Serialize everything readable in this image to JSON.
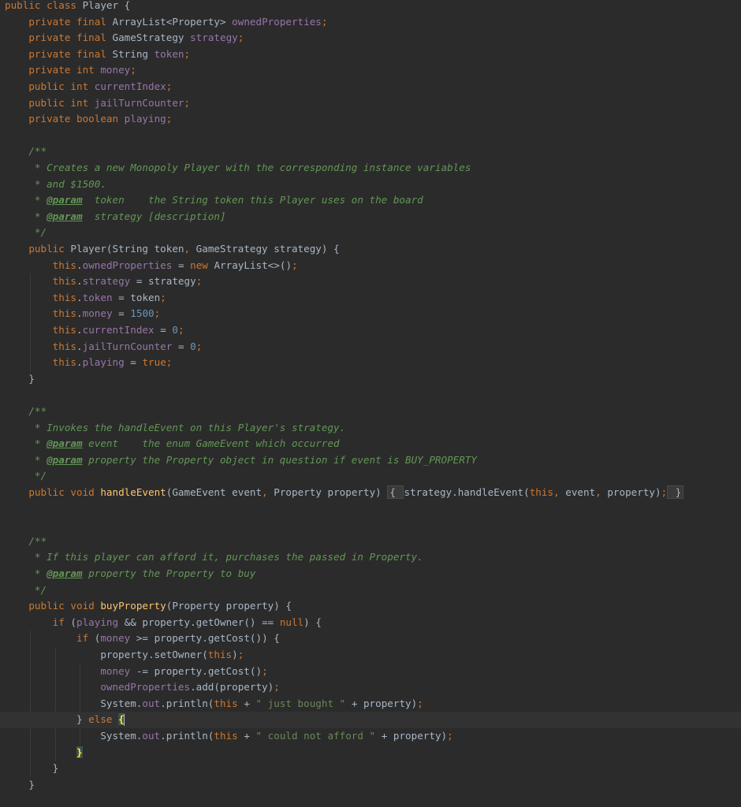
{
  "editor": {
    "language": "java",
    "lines": [
      {
        "tokens": [
          [
            "kw",
            "public "
          ],
          [
            "kw",
            "class "
          ],
          [
            "plain",
            "Player {"
          ]
        ]
      },
      {
        "tokens": [
          [
            "plain",
            "    "
          ],
          [
            "kw",
            "private final "
          ],
          [
            "plain",
            "ArrayList<Property> "
          ],
          [
            "field",
            "ownedProperties"
          ],
          [
            "punc",
            ";"
          ]
        ]
      },
      {
        "tokens": [
          [
            "plain",
            "    "
          ],
          [
            "kw",
            "private final "
          ],
          [
            "plain",
            "GameStrategy "
          ],
          [
            "field",
            "strategy"
          ],
          [
            "punc",
            ";"
          ]
        ]
      },
      {
        "tokens": [
          [
            "plain",
            "    "
          ],
          [
            "kw",
            "private final "
          ],
          [
            "plain",
            "String "
          ],
          [
            "field",
            "token"
          ],
          [
            "punc",
            ";"
          ]
        ]
      },
      {
        "tokens": [
          [
            "plain",
            "    "
          ],
          [
            "kw",
            "private int "
          ],
          [
            "field",
            "money"
          ],
          [
            "punc",
            ";"
          ]
        ]
      },
      {
        "tokens": [
          [
            "plain",
            "    "
          ],
          [
            "kw",
            "public int "
          ],
          [
            "field",
            "currentIndex"
          ],
          [
            "punc",
            ";"
          ]
        ]
      },
      {
        "tokens": [
          [
            "plain",
            "    "
          ],
          [
            "kw",
            "public int "
          ],
          [
            "field",
            "jailTurnCounter"
          ],
          [
            "punc",
            ";"
          ]
        ]
      },
      {
        "tokens": [
          [
            "plain",
            "    "
          ],
          [
            "kw",
            "private boolean "
          ],
          [
            "field",
            "playing"
          ],
          [
            "punc",
            ";"
          ]
        ]
      },
      {
        "tokens": []
      },
      {
        "tokens": [
          [
            "doc",
            "    /**"
          ]
        ]
      },
      {
        "tokens": [
          [
            "doc",
            "     * Creates a new Monopoly Player with the corresponding instance variables"
          ]
        ]
      },
      {
        "tokens": [
          [
            "doc",
            "     * and $1500."
          ]
        ]
      },
      {
        "tokens": [
          [
            "doc",
            "     * "
          ],
          [
            "tag",
            "@param"
          ],
          [
            "doc",
            "  token    the String token this Player uses on the board"
          ]
        ]
      },
      {
        "tokens": [
          [
            "doc",
            "     * "
          ],
          [
            "tag",
            "@param"
          ],
          [
            "doc",
            "  strategy [description]"
          ]
        ]
      },
      {
        "tokens": [
          [
            "doc",
            "     */"
          ]
        ]
      },
      {
        "tokens": [
          [
            "plain",
            "    "
          ],
          [
            "kw",
            "public "
          ],
          [
            "plain",
            "Player(String token"
          ],
          [
            "punc",
            ", "
          ],
          [
            "plain",
            "GameStrategy strategy) {"
          ]
        ]
      },
      {
        "tokens": [
          [
            "plain",
            "        "
          ],
          [
            "kw",
            "this"
          ],
          [
            "plain",
            "."
          ],
          [
            "field",
            "ownedProperties "
          ],
          [
            "plain",
            "= "
          ],
          [
            "kw",
            "new "
          ],
          [
            "plain",
            "ArrayList<>()"
          ],
          [
            "punc",
            ";"
          ]
        ]
      },
      {
        "tokens": [
          [
            "plain",
            "        "
          ],
          [
            "kw",
            "this"
          ],
          [
            "plain",
            "."
          ],
          [
            "field",
            "strategy "
          ],
          [
            "plain",
            "= strategy"
          ],
          [
            "punc",
            ";"
          ]
        ]
      },
      {
        "tokens": [
          [
            "plain",
            "        "
          ],
          [
            "kw",
            "this"
          ],
          [
            "plain",
            "."
          ],
          [
            "field",
            "token "
          ],
          [
            "plain",
            "= token"
          ],
          [
            "punc",
            ";"
          ]
        ]
      },
      {
        "tokens": [
          [
            "plain",
            "        "
          ],
          [
            "kw",
            "this"
          ],
          [
            "plain",
            "."
          ],
          [
            "field",
            "money "
          ],
          [
            "plain",
            "= "
          ],
          [
            "num",
            "1500"
          ],
          [
            "punc",
            ";"
          ]
        ]
      },
      {
        "tokens": [
          [
            "plain",
            "        "
          ],
          [
            "kw",
            "this"
          ],
          [
            "plain",
            "."
          ],
          [
            "field",
            "currentIndex "
          ],
          [
            "plain",
            "= "
          ],
          [
            "num",
            "0"
          ],
          [
            "punc",
            ";"
          ]
        ]
      },
      {
        "tokens": [
          [
            "plain",
            "        "
          ],
          [
            "kw",
            "this"
          ],
          [
            "plain",
            "."
          ],
          [
            "field",
            "jailTurnCounter "
          ],
          [
            "plain",
            "= "
          ],
          [
            "num",
            "0"
          ],
          [
            "punc",
            ";"
          ]
        ]
      },
      {
        "tokens": [
          [
            "plain",
            "        "
          ],
          [
            "kw",
            "this"
          ],
          [
            "plain",
            "."
          ],
          [
            "field",
            "playing "
          ],
          [
            "plain",
            "= "
          ],
          [
            "kw",
            "true"
          ],
          [
            "punc",
            ";"
          ]
        ]
      },
      {
        "tokens": [
          [
            "plain",
            "    }"
          ]
        ]
      },
      {
        "tokens": []
      },
      {
        "tokens": [
          [
            "doc",
            "    /**"
          ]
        ]
      },
      {
        "tokens": [
          [
            "doc",
            "     * Invokes the handleEvent on this Player's strategy."
          ]
        ]
      },
      {
        "tokens": [
          [
            "doc",
            "     * "
          ],
          [
            "tag",
            "@param"
          ],
          [
            "doc",
            " event    the enum GameEvent which occurred"
          ]
        ]
      },
      {
        "tokens": [
          [
            "doc",
            "     * "
          ],
          [
            "tag",
            "@param"
          ],
          [
            "doc",
            " property the Property object in question if event is BUY_PROPERTY"
          ]
        ]
      },
      {
        "tokens": [
          [
            "doc",
            "     */"
          ]
        ]
      },
      {
        "tokens": [
          [
            "plain",
            "    "
          ],
          [
            "kw",
            "public void "
          ],
          [
            "method",
            "handleEvent"
          ],
          [
            "plain",
            "(GameEvent event"
          ],
          [
            "punc",
            ", "
          ],
          [
            "plain",
            "Property property) "
          ],
          [
            "folded",
            "{ "
          ],
          [
            "plain",
            "strategy.handleEvent("
          ],
          [
            "kw",
            "this"
          ],
          [
            "punc",
            ", "
          ],
          [
            "plain",
            "event"
          ],
          [
            "punc",
            ", "
          ],
          [
            "plain",
            "property)"
          ],
          [
            "punc",
            ";"
          ],
          [
            "folded",
            " }"
          ]
        ]
      },
      {
        "tokens": []
      },
      {
        "tokens": []
      },
      {
        "tokens": [
          [
            "doc",
            "    /**"
          ]
        ]
      },
      {
        "tokens": [
          [
            "doc",
            "     * If this player can afford it, purchases the passed in Property."
          ]
        ]
      },
      {
        "tokens": [
          [
            "doc",
            "     * "
          ],
          [
            "tag",
            "@param"
          ],
          [
            "doc",
            " property the Property to buy"
          ]
        ]
      },
      {
        "tokens": [
          [
            "doc",
            "     */"
          ]
        ]
      },
      {
        "tokens": [
          [
            "plain",
            "    "
          ],
          [
            "kw",
            "public void "
          ],
          [
            "method",
            "buyProperty"
          ],
          [
            "plain",
            "(Property property) {"
          ]
        ]
      },
      {
        "tokens": [
          [
            "plain",
            "        "
          ],
          [
            "kw",
            "if "
          ],
          [
            "plain",
            "("
          ],
          [
            "field",
            "playing "
          ],
          [
            "plain",
            "&& property.getOwner() == "
          ],
          [
            "kw",
            "null"
          ],
          [
            "plain",
            ") {"
          ]
        ]
      },
      {
        "tokens": [
          [
            "plain",
            "            "
          ],
          [
            "kw",
            "if "
          ],
          [
            "plain",
            "("
          ],
          [
            "field",
            "money "
          ],
          [
            "plain",
            ">= property.getCost()) {"
          ]
        ]
      },
      {
        "tokens": [
          [
            "plain",
            "                property.setOwner("
          ],
          [
            "kw",
            "this"
          ],
          [
            "plain",
            ")"
          ],
          [
            "punc",
            ";"
          ]
        ]
      },
      {
        "tokens": [
          [
            "plain",
            "                "
          ],
          [
            "field",
            "money "
          ],
          [
            "plain",
            "-= property.getCost()"
          ],
          [
            "punc",
            ";"
          ]
        ]
      },
      {
        "tokens": [
          [
            "plain",
            "                "
          ],
          [
            "field",
            "ownedProperties"
          ],
          [
            "plain",
            ".add(property)"
          ],
          [
            "punc",
            ";"
          ]
        ]
      },
      {
        "tokens": [
          [
            "plain",
            "                System."
          ],
          [
            "field",
            "out"
          ],
          [
            "plain",
            ".println("
          ],
          [
            "kw",
            "this "
          ],
          [
            "plain",
            "+ "
          ],
          [
            "str",
            "\" just bought \" "
          ],
          [
            "plain",
            "+ property)"
          ],
          [
            "punc",
            ";"
          ]
        ]
      },
      {
        "tokens": [
          [
            "plain",
            "            } "
          ],
          [
            "kw",
            "else "
          ],
          [
            "brace",
            "{"
          ],
          [
            "cursor",
            ""
          ]
        ],
        "current": true
      },
      {
        "tokens": [
          [
            "plain",
            "                System."
          ],
          [
            "field",
            "out"
          ],
          [
            "plain",
            ".println("
          ],
          [
            "kw",
            "this "
          ],
          [
            "plain",
            "+ "
          ],
          [
            "str",
            "\" could not afford \" "
          ],
          [
            "plain",
            "+ property)"
          ],
          [
            "punc",
            ";"
          ]
        ]
      },
      {
        "tokens": [
          [
            "plain",
            "            "
          ],
          [
            "brace",
            "}"
          ]
        ]
      },
      {
        "tokens": [
          [
            "plain",
            "        }"
          ]
        ]
      },
      {
        "tokens": [
          [
            "plain",
            "    }"
          ]
        ]
      }
    ]
  }
}
